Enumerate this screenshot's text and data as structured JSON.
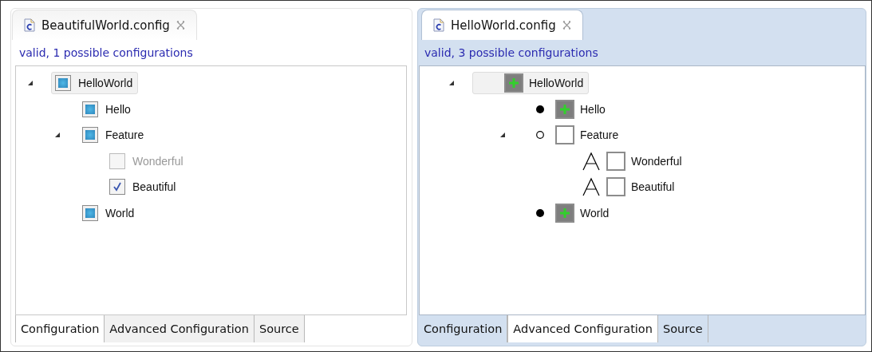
{
  "editors": [
    {
      "title": "BeautifulWorld.config",
      "active": false,
      "status": "valid, 1 possible configurations",
      "kind": "basic",
      "tree": [
        {
          "label": "HelloWorld",
          "kind": "automatic",
          "checked": true,
          "disabled": false,
          "highlighted": true,
          "expanded": true,
          "children": [
            {
              "label": "Hello",
              "kind": "automatic",
              "checked": true,
              "disabled": false,
              "highlighted": false
            },
            {
              "label": "Feature",
              "kind": "automatic",
              "checked": true,
              "disabled": false,
              "highlighted": false,
              "expanded": true,
              "children": [
                {
                  "label": "Wonderful",
                  "kind": "manual",
                  "checked": false,
                  "disabled": true,
                  "highlighted": false
                },
                {
                  "label": "Beautiful",
                  "kind": "manual",
                  "checked": true,
                  "disabled": false,
                  "highlighted": false
                }
              ]
            },
            {
              "label": "World",
              "kind": "automatic",
              "checked": true,
              "disabled": false,
              "highlighted": false
            }
          ]
        }
      ],
      "pages": [
        {
          "label": "Configuration",
          "selected": true
        },
        {
          "label": "Advanced Configuration",
          "selected": false
        },
        {
          "label": "Source",
          "selected": false
        }
      ]
    },
    {
      "title": "HelloWorld.config",
      "active": true,
      "status": "valid, 3 possible configurations",
      "kind": "advanced",
      "tree": [
        {
          "label": "HelloWorld",
          "kind": "root",
          "selected": true,
          "highlighted": true,
          "expanded": true,
          "children": [
            {
              "label": "Hello",
              "kind": "mandatory",
              "selected": true,
              "highlighted": false
            },
            {
              "label": "Feature",
              "kind": "optional",
              "selected": false,
              "highlighted": false,
              "expanded": true,
              "children": [
                {
                  "label": "Wonderful",
                  "kind": "alternative",
                  "selected": false,
                  "highlighted": false
                },
                {
                  "label": "Beautiful",
                  "kind": "alternative",
                  "selected": false,
                  "highlighted": false
                }
              ]
            },
            {
              "label": "World",
              "kind": "mandatory",
              "selected": true,
              "highlighted": false
            }
          ]
        }
      ],
      "pages": [
        {
          "label": "Configuration",
          "selected": false
        },
        {
          "label": "Advanced Configuration",
          "selected": true
        },
        {
          "label": "Source",
          "selected": false
        }
      ]
    }
  ]
}
